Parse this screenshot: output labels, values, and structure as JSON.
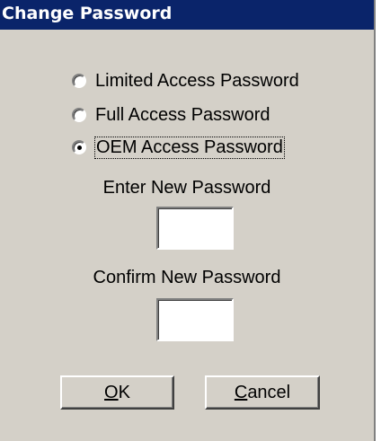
{
  "dialog": {
    "title": "Change Password"
  },
  "password_type": {
    "options": [
      {
        "label": "Limited Access Password",
        "selected": false
      },
      {
        "label": "Full Access Password",
        "selected": false
      },
      {
        "label": "OEM Access Password",
        "selected": true
      }
    ]
  },
  "new_password": {
    "label": "Enter New Password",
    "value": ""
  },
  "confirm_password": {
    "label": "Confirm New Password",
    "value": ""
  },
  "buttons": {
    "ok": {
      "mnemonic": "O",
      "rest": "K"
    },
    "cancel": {
      "mnemonic": "C",
      "rest": "ancel"
    }
  },
  "colors": {
    "titlebar": "#0a246a",
    "dialog_face": "#d4d0c8",
    "title_text": "#ffffff"
  }
}
